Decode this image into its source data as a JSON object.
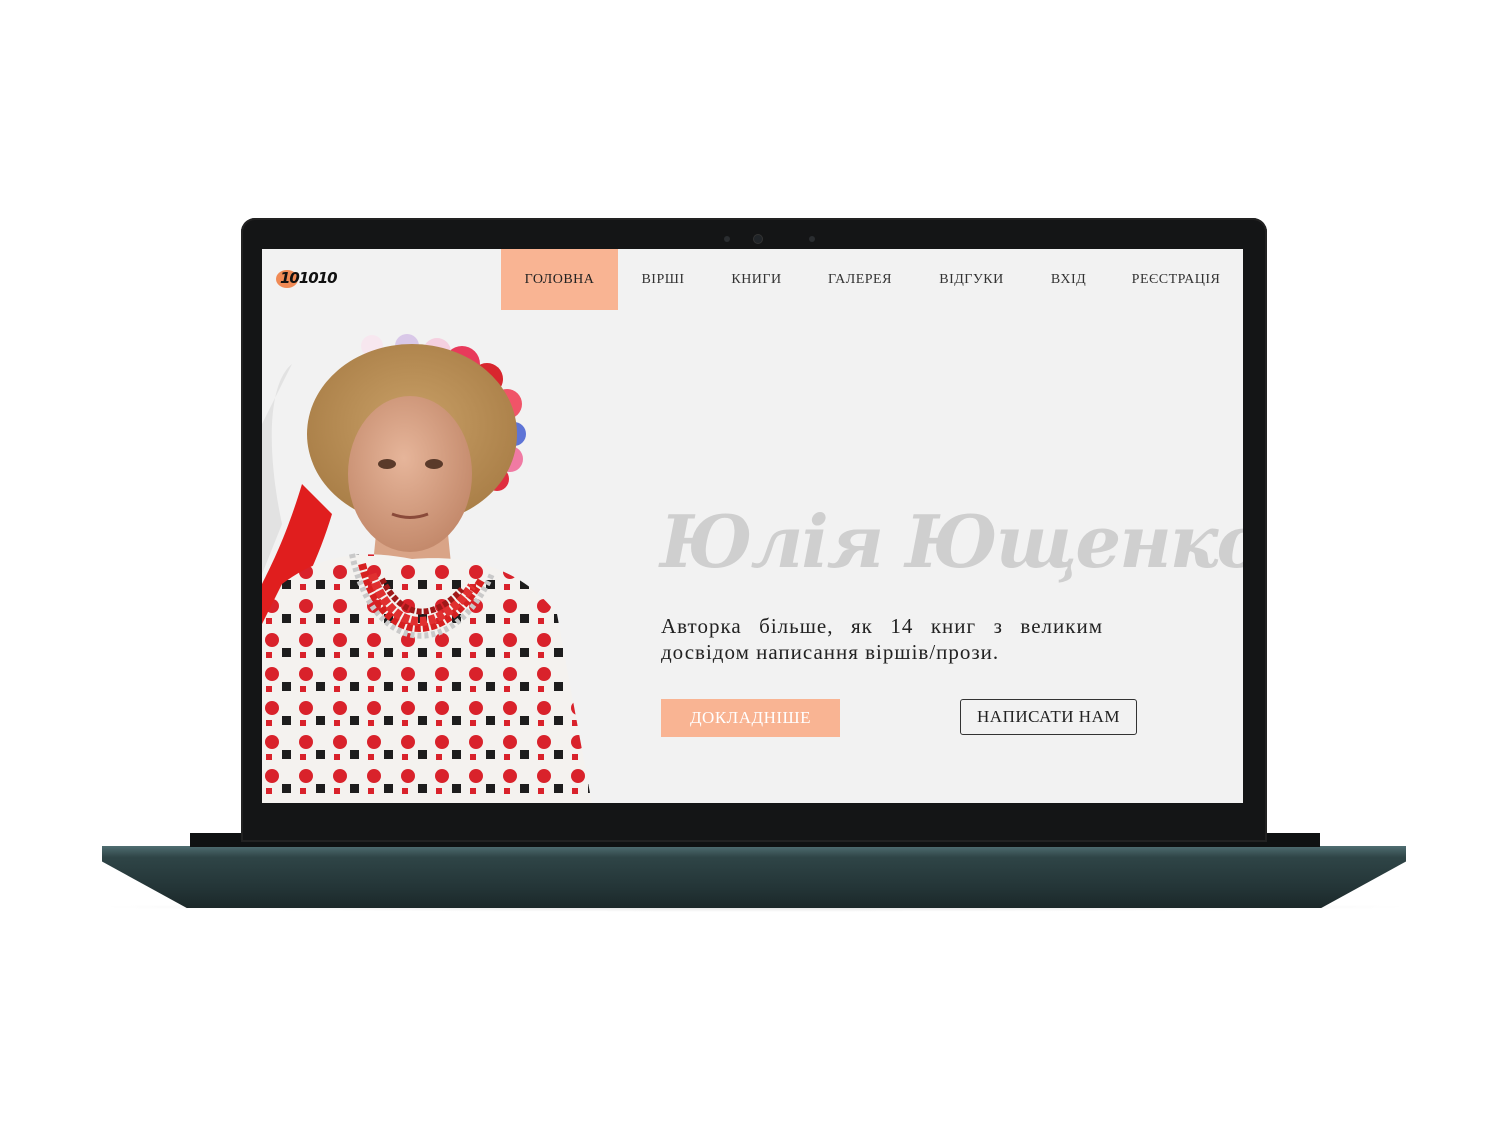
{
  "site": {
    "logo_text": "101010"
  },
  "nav": {
    "items": [
      {
        "label": "ГОЛОВНА",
        "active": true
      },
      {
        "label": "ВІРШІ",
        "active": false
      },
      {
        "label": "КНИГИ",
        "active": false
      },
      {
        "label": "ГАЛЕРЕЯ",
        "active": false
      },
      {
        "label": "ВІДГУКИ",
        "active": false
      },
      {
        "label": "ВХІД",
        "active": false
      },
      {
        "label": "РЕЄСТРАЦІЯ",
        "active": false
      }
    ]
  },
  "hero": {
    "name": "Юлія Ющенко",
    "description": "Авторка більше, як 14 книг з великим досвідом написання віршів/прози.",
    "primary_button": "ДОКЛАДНІШЕ",
    "secondary_button": "НАПИСАТИ НАМ"
  },
  "colors": {
    "accent": "#f9b493",
    "background": "#f2f2f2",
    "name_color": "#cfcfcf",
    "frame": "#141516",
    "base": "#2f4547"
  }
}
